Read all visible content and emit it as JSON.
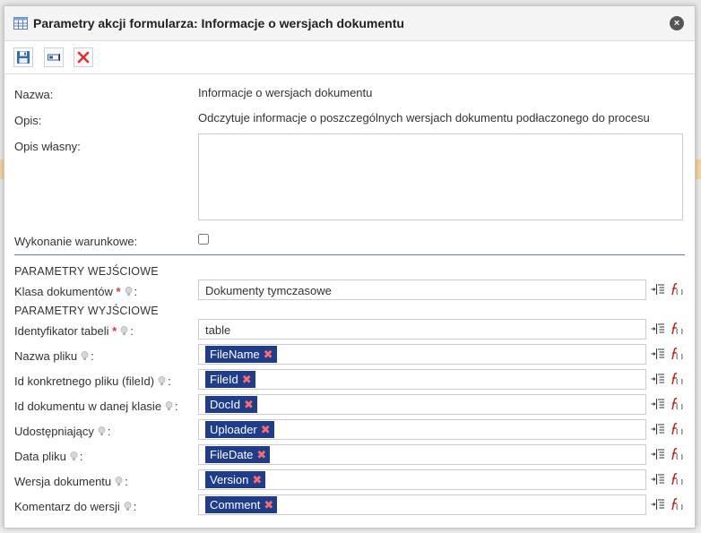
{
  "dialog": {
    "title": "Parametry akcji formularza: Informacje o wersjach dokumentu",
    "close_glyph": "×"
  },
  "form": {
    "name_label": "Nazwa:",
    "name_value": "Informacje o wersjach dokumentu",
    "desc_label": "Opis:",
    "desc_value": "Odczytuje informacje o poszczególnych wersjach dokumentu podłaczonego do procesu",
    "own_desc_label": "Opis własny:",
    "own_desc_value": "",
    "conditional_label": "Wykonanie warunkowe:",
    "conditional_checked": false
  },
  "sections": {
    "input": "PARAMETRY WEJŚCIOWE",
    "output": "PARAMETRY WYJŚCIOWE"
  },
  "input_params": [
    {
      "label": "Klasa dokumentów",
      "required": true,
      "value": "Dokumenty tymczasowe",
      "kind": "text"
    }
  ],
  "output_params": [
    {
      "label": "Identyfikator tabeli",
      "required": true,
      "value": "table",
      "kind": "text"
    },
    {
      "label": "Nazwa pliku",
      "required": false,
      "value": "FileName",
      "kind": "tag"
    },
    {
      "label": "Id konkretnego pliku (fileId)",
      "required": false,
      "value": "FileId",
      "kind": "tag"
    },
    {
      "label": "Id dokumentu w danej klasie",
      "required": false,
      "value": "DocId",
      "kind": "tag"
    },
    {
      "label": "Udostępniający",
      "required": false,
      "value": "Uploader",
      "kind": "tag"
    },
    {
      "label": "Data pliku",
      "required": false,
      "value": "FileDate",
      "kind": "tag"
    },
    {
      "label": "Wersja dokumentu",
      "required": false,
      "value": "Version",
      "kind": "tag"
    },
    {
      "label": "Komentarz do wersji",
      "required": false,
      "value": "Comment",
      "kind": "tag"
    }
  ],
  "colors": {
    "tag_bg": "#1f3d8a",
    "tag_remove": "#ff6b6b",
    "required_star": "#dd3333",
    "separator": "#6b7d96"
  },
  "icons": {
    "title": "table-icon",
    "save": "save-icon",
    "rename": "input-field-icon",
    "cancel": "cancel-icon",
    "hint": "lightbulb-icon",
    "add_variable": "add-variable-icon",
    "function": "function-icon"
  }
}
